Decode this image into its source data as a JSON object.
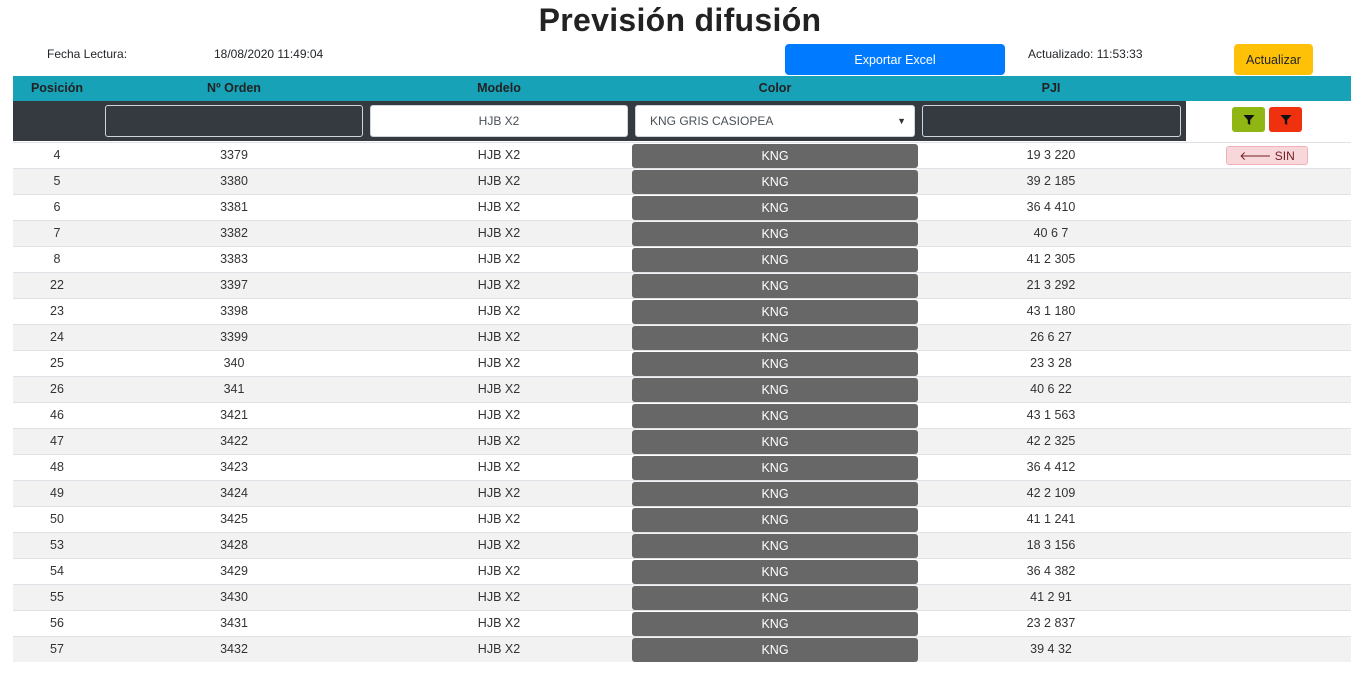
{
  "header": {
    "title": "Previsión difusión",
    "fecha_label": "Fecha Lectura:",
    "fecha_value": "18/08/2020 11:49:04",
    "export_label": "Exportar Excel",
    "updated_text": "Actualizado: 11:53:33",
    "refresh_label": "Actualizar"
  },
  "table": {
    "columns": [
      "Posición",
      "Nº Orden",
      "Modelo",
      "Color",
      "PJI"
    ],
    "filters": {
      "orden": "",
      "modelo": "HJB X2",
      "color": "KNG GRIS CASIOPEA",
      "pji": ""
    },
    "filter_apply_icon": "filter-icon",
    "filter_clear_icon": "filter-clear-icon",
    "colors": {
      "header_bg": "#17a2b8",
      "filter_bg": "#343a40",
      "color_cell_bg": "#676767",
      "apply_btn": "#8fb612",
      "clear_btn": "#f0310f",
      "export_btn": "#007bff",
      "refresh_btn": "#ffc107"
    },
    "rows": [
      {
        "pos": "4",
        "orden": "3379",
        "modelo": "HJB X2",
        "color": "KNG",
        "pji": "19 3 220",
        "action": "🡐 SIN STOCK"
      },
      {
        "pos": "5",
        "orden": "3380",
        "modelo": "HJB X2",
        "color": "KNG",
        "pji": "39 2 185",
        "action": ""
      },
      {
        "pos": "6",
        "orden": "3381",
        "modelo": "HJB X2",
        "color": "KNG",
        "pji": "36 4 410",
        "action": ""
      },
      {
        "pos": "7",
        "orden": "3382",
        "modelo": "HJB X2",
        "color": "KNG",
        "pji": "40 6 7",
        "action": ""
      },
      {
        "pos": "8",
        "orden": "3383",
        "modelo": "HJB X2",
        "color": "KNG",
        "pji": "41 2 305",
        "action": ""
      },
      {
        "pos": "22",
        "orden": "3397",
        "modelo": "HJB X2",
        "color": "KNG",
        "pji": "21 3 292",
        "action": ""
      },
      {
        "pos": "23",
        "orden": "3398",
        "modelo": "HJB X2",
        "color": "KNG",
        "pji": "43 1 180",
        "action": ""
      },
      {
        "pos": "24",
        "orden": "3399",
        "modelo": "HJB X2",
        "color": "KNG",
        "pji": "26 6 27",
        "action": ""
      },
      {
        "pos": "25",
        "orden": "340",
        "modelo": "HJB X2",
        "color": "KNG",
        "pji": "23 3 28",
        "action": ""
      },
      {
        "pos": "26",
        "orden": "341",
        "modelo": "HJB X2",
        "color": "KNG",
        "pji": "40 6 22",
        "action": ""
      },
      {
        "pos": "46",
        "orden": "3421",
        "modelo": "HJB X2",
        "color": "KNG",
        "pji": "43 1 563",
        "action": ""
      },
      {
        "pos": "47",
        "orden": "3422",
        "modelo": "HJB X2",
        "color": "KNG",
        "pji": "42 2 325",
        "action": ""
      },
      {
        "pos": "48",
        "orden": "3423",
        "modelo": "HJB X2",
        "color": "KNG",
        "pji": "36 4 412",
        "action": ""
      },
      {
        "pos": "49",
        "orden": "3424",
        "modelo": "HJB X2",
        "color": "KNG",
        "pji": "42 2 109",
        "action": ""
      },
      {
        "pos": "50",
        "orden": "3425",
        "modelo": "HJB X2",
        "color": "KNG",
        "pji": "41 1 241",
        "action": ""
      },
      {
        "pos": "53",
        "orden": "3428",
        "modelo": "HJB X2",
        "color": "KNG",
        "pji": "18 3 156",
        "action": ""
      },
      {
        "pos": "54",
        "orden": "3429",
        "modelo": "HJB X2",
        "color": "KNG",
        "pji": "36 4 382",
        "action": ""
      },
      {
        "pos": "55",
        "orden": "3430",
        "modelo": "HJB X2",
        "color": "KNG",
        "pji": "41 2 91",
        "action": ""
      },
      {
        "pos": "56",
        "orden": "3431",
        "modelo": "HJB X2",
        "color": "KNG",
        "pji": "23 2 837",
        "action": ""
      },
      {
        "pos": "57",
        "orden": "3432",
        "modelo": "HJB X2",
        "color": "KNG",
        "pji": "39 4 32",
        "action": ""
      }
    ]
  }
}
